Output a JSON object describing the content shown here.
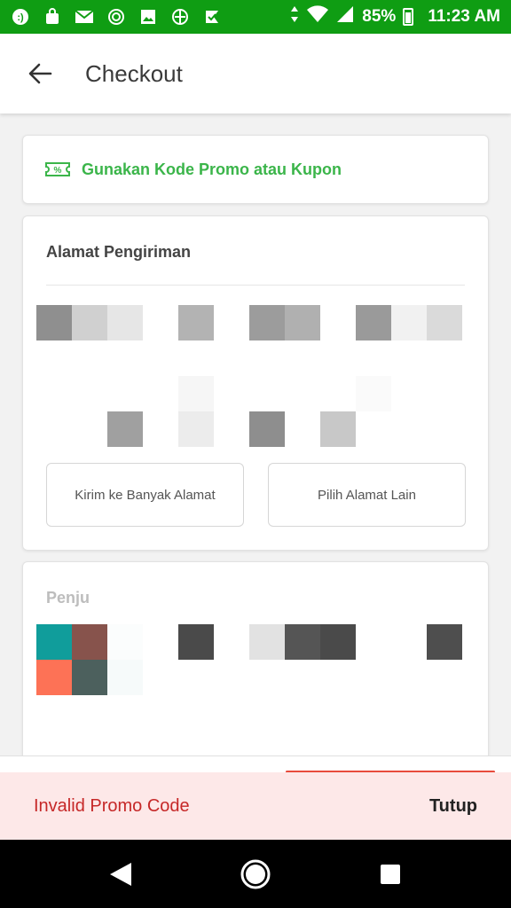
{
  "status_bar": {
    "battery": "85%",
    "time": "11:23 AM",
    "bg_color": "#0f9d13",
    "icons": [
      "app-icon",
      "bag-icon",
      "mail-icon",
      "target-icon",
      "image-icon",
      "vpn-icon",
      "check-icon",
      "data-arrows-icon",
      "wifi-icon",
      "signal-icon",
      "battery-icon"
    ]
  },
  "app_bar": {
    "title": "Checkout"
  },
  "promo": {
    "label": "Gunakan Kode Promo atau Kupon",
    "color": "#3bb54a"
  },
  "address": {
    "title": "Alamat Pengiriman",
    "multi_button": "Kirim ke Banyak Alamat",
    "other_button": "Pilih Alamat Lain"
  },
  "seller": {
    "title": "Penju"
  },
  "toast": {
    "message": "Invalid Promo Code",
    "action": "Tutup",
    "message_color": "#c62828",
    "bg_color": "#fde8e8"
  },
  "nav": {
    "icons": [
      "back-triangle-icon",
      "home-circle-icon",
      "recents-square-icon"
    ]
  }
}
